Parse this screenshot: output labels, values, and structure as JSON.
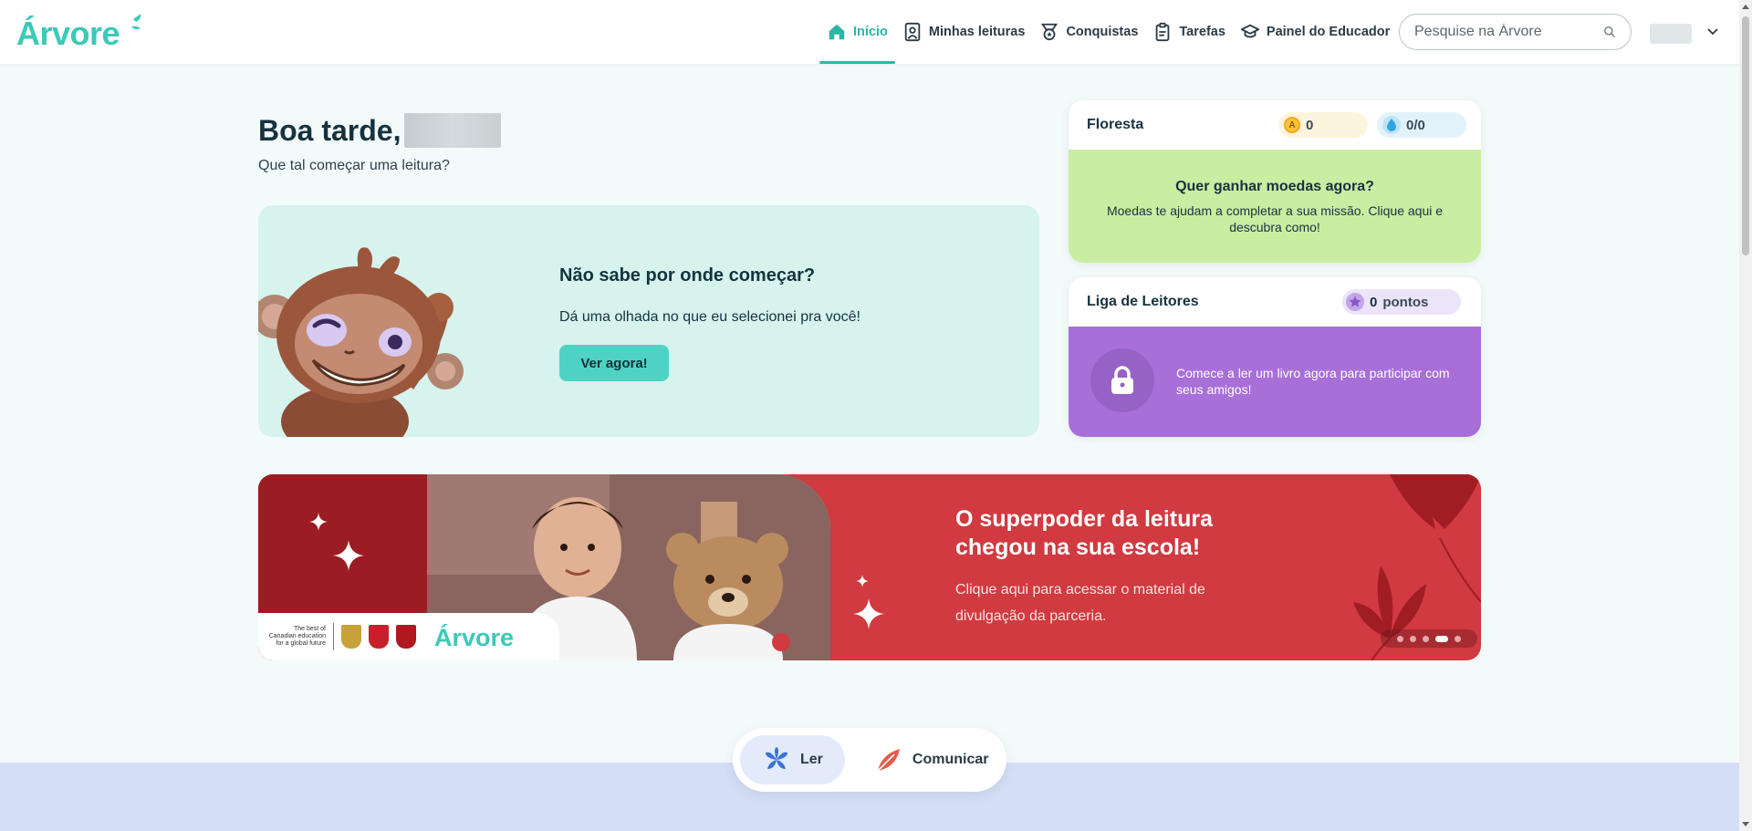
{
  "header": {
    "logo_text": "Árvore",
    "nav": [
      {
        "label": "Início",
        "icon": "home-icon",
        "active": true
      },
      {
        "label": "Minhas leituras",
        "icon": "reader-icon",
        "active": false
      },
      {
        "label": "Conquistas",
        "icon": "medal-icon",
        "active": false
      },
      {
        "label": "Tarefas",
        "icon": "clipboard-icon",
        "active": false
      },
      {
        "label": "Painel do Educador",
        "icon": "graduation-cap-icon",
        "active": false
      }
    ],
    "search_placeholder": "Pesquise na Árvore"
  },
  "greeting": {
    "title": "Boa tarde,",
    "subtitle": "Que tal começar uma leitura?"
  },
  "suggestion": {
    "title": "Não sabe por onde começar?",
    "text": "Dá uma olhada no que eu selecionei pra você!",
    "button": "Ver agora!"
  },
  "floresta": {
    "title": "Floresta",
    "coins": "0",
    "coin_letter": "A",
    "water": "0/0",
    "cta_title": "Quer ganhar moedas agora?",
    "cta_text": "Moedas te ajudam a completar a sua missão. Clique aqui e descubra como!"
  },
  "liga": {
    "title": "Liga de Leitores",
    "points_value": "0",
    "points_label": "pontos",
    "text": "Comece a ler um livro agora para participar com seus amigos!"
  },
  "banner": {
    "title": "O superpoder da leitura chegou na sua escola!",
    "text": "Clique aqui para acessar o material de divulgação da parceria.",
    "partner_tagline": "The best of Canadian education for a global future",
    "logo_text": "Árvore",
    "slides": 5,
    "active_slide": 4
  },
  "toggle": {
    "read_label": "Ler",
    "communicate_label": "Comunicar"
  },
  "colors": {
    "accent": "#2db5a7",
    "coins_bg": "#c8eea2",
    "liga_bg": "#a86fd9",
    "banner_bg": "#d03a40"
  }
}
